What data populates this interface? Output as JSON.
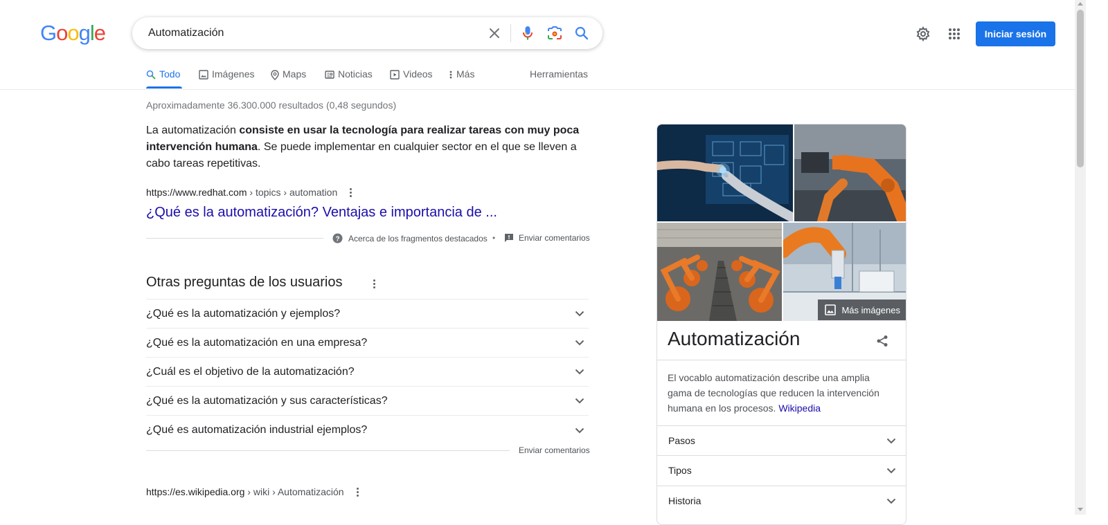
{
  "logo": {
    "letters": [
      "G",
      "o",
      "o",
      "g",
      "l",
      "e"
    ],
    "colors": [
      "#4285f4",
      "#ea4335",
      "#fbbc05",
      "#4285f4",
      "#34a853",
      "#ea4335"
    ]
  },
  "search": {
    "query": "Automatización"
  },
  "header": {
    "signin_label": "Iniciar sesión"
  },
  "tabs": {
    "items": [
      {
        "label": "Todo",
        "icon": "search-icon",
        "active": true
      },
      {
        "label": "Imágenes",
        "icon": "image-icon"
      },
      {
        "label": "Maps",
        "icon": "map-pin-icon"
      },
      {
        "label": "Noticias",
        "icon": "news-icon"
      },
      {
        "label": "Videos",
        "icon": "video-icon"
      },
      {
        "label": "Más",
        "icon": "more-vert-icon"
      }
    ],
    "tools": "Herramientas"
  },
  "results": {
    "stats": "Aproximadamente 36.300.000 resultados (0,48 segundos)",
    "snippet": {
      "text_before": "La automatización ",
      "text_bold": "consiste en usar la tecnología para realizar tareas con muy poca intervención humana",
      "text_after": ". Se puede implementar en cualquier sector en el que se lleven a cabo tareas repetitivas.",
      "source_domain": "https://www.redhat.com",
      "source_crumb": " › topics › automation",
      "link_title": "¿Qué es la automatización? Ventajas e importancia de ...",
      "about_label": "Acerca de los fragmentos destacados",
      "separator": "•",
      "feedback_label": "Enviar comentarios"
    },
    "paa": {
      "title": "Otras preguntas de los usuarios",
      "questions": [
        "¿Qué es la automatización y ejemplos?",
        "¿Qué es la automatización en una empresa?",
        "¿Cuál es el objetivo de la automatización?",
        "¿Qué es la automatización y sus características?",
        "¿Qué es automatización industrial ejemplos?"
      ],
      "feedback_label": "Enviar comentarios"
    },
    "wiki": {
      "source_domain": "https://es.wikipedia.org",
      "source_crumb": " › wiki › Automatización"
    }
  },
  "knowledge_panel": {
    "more_images_label": "Más imágenes",
    "title": "Automatización",
    "description": "El vocablo automatización describe una amplia gama de tecnologías que reducen la intervención humana en los procesos. ",
    "description_link": "Wikipedia",
    "sections": [
      "Pasos",
      "Tipos",
      "Historia"
    ]
  },
  "colors": {
    "accent": "#1a73e8",
    "link": "#1a0dab"
  }
}
